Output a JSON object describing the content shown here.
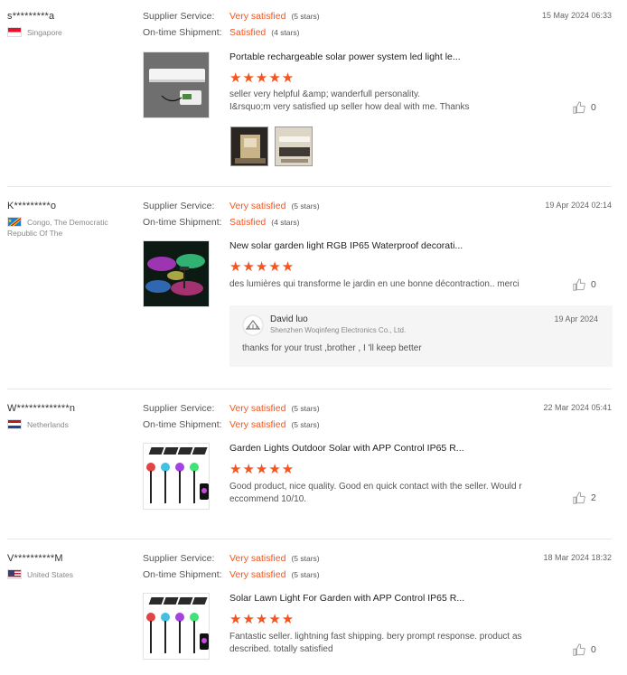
{
  "labels": {
    "supplier_service": "Supplier Service:",
    "ontime_shipment": "On-time Shipment:"
  },
  "colors": {
    "accent": "#f5541f"
  },
  "reviews": [
    {
      "buyer": "s*********a",
      "country": "Singapore",
      "flag": "singapore",
      "supplier_rating": "Very satisfied",
      "supplier_stars": "(5 stars)",
      "shipment_rating": "Satisfied",
      "shipment_stars": "(4 stars)",
      "date": "15 May 2024 06:33",
      "product_title": "Portable rechargeable solar power system led light le...",
      "stars": "★★★★★",
      "text": "seller very helpful &amp; wanderfull personality.\nI&rsquo;m very satisfied up seller how deal with me. Thanks",
      "helpful_count": "0"
    },
    {
      "buyer": "K*********o",
      "country": "Congo, The Democratic Republic Of The",
      "flag": "congo-drc",
      "supplier_rating": "Very satisfied",
      "supplier_stars": "(5 stars)",
      "shipment_rating": "Satisfied",
      "shipment_stars": "(4 stars)",
      "date": "19 Apr 2024 02:14",
      "product_title": "New solar garden light RGB IP65 Waterproof decorati...",
      "stars": "★★★★★",
      "text": "des lumières qui transforme le jardin en une bonne décontraction.. merci",
      "helpful_count": "0",
      "reply": {
        "name": "David luo",
        "company": "Shenzhen Woqinfeng Electronics Co., Ltd.",
        "date": "19 Apr 2024",
        "text": "thanks for your trust ,brother , I 'll keep better"
      }
    },
    {
      "buyer": "W*************n",
      "country": "Netherlands",
      "flag": "netherlands",
      "supplier_rating": "Very satisfied",
      "supplier_stars": "(5 stars)",
      "shipment_rating": "Very satisfied",
      "shipment_stars": "(5 stars)",
      "date": "22 Mar 2024 05:41",
      "product_title": "Garden Lights Outdoor Solar with APP Control IP65 R...",
      "stars": "★★★★★",
      "text": "Good product, nice quality. Good en quick contact with the seller. Would r\neccommend 10/10.",
      "helpful_count": "2"
    },
    {
      "buyer": "V**********M",
      "country": "United States",
      "flag": "united-states",
      "supplier_rating": "Very satisfied",
      "supplier_stars": "(5 stars)",
      "shipment_rating": "Very satisfied",
      "shipment_stars": "(5 stars)",
      "date": "18 Mar 2024 18:32",
      "product_title": "Solar Lawn Light For Garden with APP Control IP65 R...",
      "stars": "★★★★★",
      "text": "Fantastic seller. lightning fast shipping. bery prompt response. product as\ndescribed. totally satisfied",
      "helpful_count": "0"
    }
  ]
}
